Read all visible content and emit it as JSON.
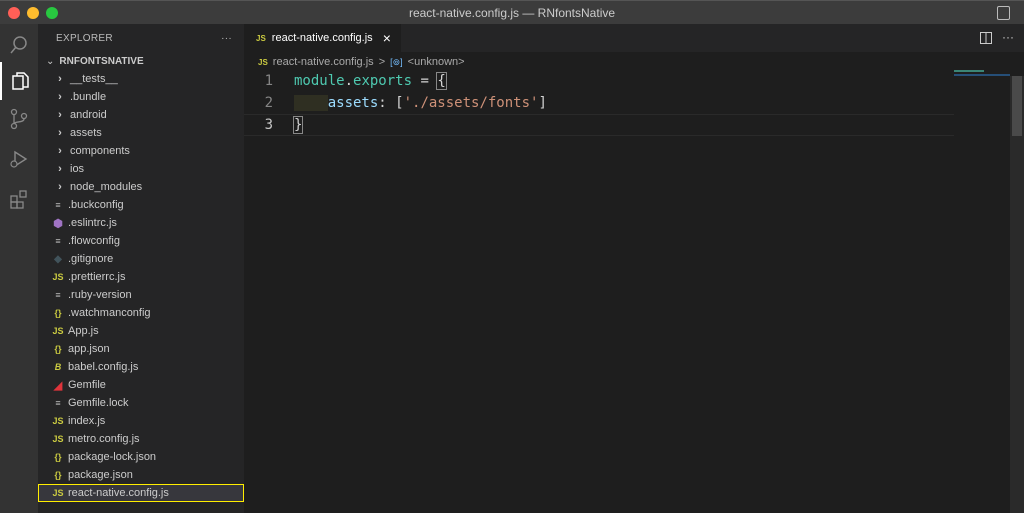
{
  "window": {
    "title": "react-native.config.js — RNfontsNative"
  },
  "sidebar": {
    "title": "EXPLORER",
    "more": "···",
    "root": "RNFONTSNATIVE",
    "items": [
      {
        "label": "__tests__",
        "type": "folder",
        "icon": "chevron-right-icon"
      },
      {
        "label": ".bundle",
        "type": "folder",
        "icon": "chevron-right-icon"
      },
      {
        "label": "android",
        "type": "folder",
        "icon": "chevron-right-icon"
      },
      {
        "label": "assets",
        "type": "folder",
        "icon": "chevron-right-icon"
      },
      {
        "label": "components",
        "type": "folder",
        "icon": "chevron-right-icon"
      },
      {
        "label": "ios",
        "type": "folder",
        "icon": "chevron-right-icon"
      },
      {
        "label": "node_modules",
        "type": "folder",
        "icon": "chevron-right-icon"
      },
      {
        "label": ".buckconfig",
        "type": "file",
        "icon": "text-file-icon"
      },
      {
        "label": ".eslintrc.js",
        "type": "file",
        "icon": "eslint-icon"
      },
      {
        "label": ".flowconfig",
        "type": "file",
        "icon": "text-file-icon"
      },
      {
        "label": ".gitignore",
        "type": "file",
        "icon": "git-icon"
      },
      {
        "label": ".prettierrc.js",
        "type": "file",
        "icon": "js-icon"
      },
      {
        "label": ".ruby-version",
        "type": "file",
        "icon": "text-file-icon"
      },
      {
        "label": ".watchmanconfig",
        "type": "file",
        "icon": "json-icon"
      },
      {
        "label": "App.js",
        "type": "file",
        "icon": "js-icon"
      },
      {
        "label": "app.json",
        "type": "file",
        "icon": "json-icon"
      },
      {
        "label": "babel.config.js",
        "type": "file",
        "icon": "babel-icon"
      },
      {
        "label": "Gemfile",
        "type": "file",
        "icon": "ruby-icon"
      },
      {
        "label": "Gemfile.lock",
        "type": "file",
        "icon": "text-file-icon"
      },
      {
        "label": "index.js",
        "type": "file",
        "icon": "js-icon"
      },
      {
        "label": "metro.config.js",
        "type": "file",
        "icon": "js-icon"
      },
      {
        "label": "package-lock.json",
        "type": "file",
        "icon": "json-icon"
      },
      {
        "label": "package.json",
        "type": "file",
        "icon": "json-icon"
      },
      {
        "label": "react-native.config.js",
        "type": "file",
        "icon": "js-icon",
        "selected": true
      }
    ]
  },
  "icons": {
    "js": "JS",
    "json": "{}"
  },
  "editor": {
    "tab": "react-native.config.js",
    "close": "×",
    "breadcrumb": {
      "file": "react-native.config.js",
      "sep": ">",
      "symbol": "<unknown>"
    },
    "lines": [
      {
        "n": "1",
        "tokens": [
          [
            "module",
            "#4ec9b0"
          ],
          [
            ".",
            "#d4d4d4"
          ],
          [
            "exports",
            "#4ec9b0"
          ],
          [
            " = ",
            "#d4d4d4"
          ],
          [
            "{",
            "#d4d4d4"
          ]
        ]
      },
      {
        "n": "2",
        "tokens": [
          [
            "    ",
            "#d4d4d4"
          ],
          [
            "assets",
            "#9cdcfe"
          ],
          [
            ": [",
            "#d4d4d4"
          ],
          [
            "'./assets/fonts'",
            "#ce9178"
          ],
          [
            "]",
            "#d4d4d4"
          ]
        ]
      },
      {
        "n": "3",
        "tokens": [
          [
            "}",
            "#d4d4d4"
          ]
        ]
      }
    ]
  },
  "colors": {
    "accent": "#ffee00",
    "js": "#cbcb41"
  }
}
